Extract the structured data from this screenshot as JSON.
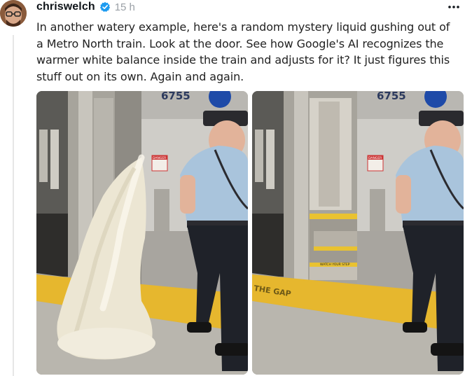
{
  "post": {
    "username": "chriswelch",
    "timestamp": "15 h",
    "text": "In another watery example, here's a random mystery liquid gushing out of a Metro North train. Look at the door. See how Google's AI recognizes the warmer white balance inside the train and adjusts for it? It just figures this stuff out on its own. Again and again.",
    "verified_color": "#1d9bf0"
  },
  "media": {
    "car_number": "6755",
    "danger_label": "DANGER",
    "step_label": "WATCH YOUR STEP",
    "platform_text": "THE GAP"
  },
  "icons": {
    "avatar": "avatar",
    "verified": "verified-badge-icon",
    "more": "more-options-icon"
  }
}
